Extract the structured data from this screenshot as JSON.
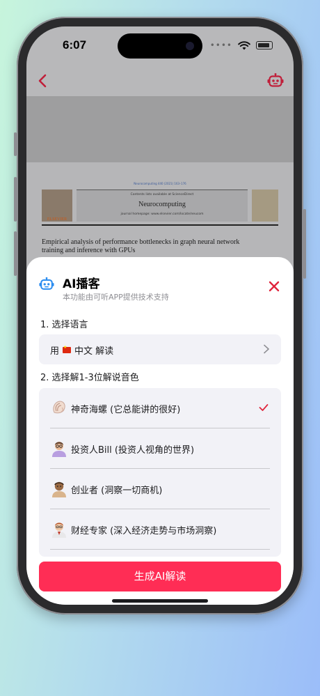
{
  "status_bar": {
    "time": "6:07",
    "dots": "••••"
  },
  "paper": {
    "journal_line": "Neurocomputing 440 (2021) 163–176",
    "contents_list": "Contents lists available at ScienceDirect",
    "journal_name": "Neurocomputing",
    "journal_homepage": "journal homepage: www.elsevier.com/locate/neucom",
    "publisher": "ELSEVIER",
    "title": "Empirical analysis of performance bottlenecks in graph neural network training and inference with GPUs"
  },
  "sheet": {
    "title": "AI播客",
    "subtitle": "本功能由可听APP提供技术支持",
    "step1_label": "1. 选择语言",
    "language_prefix": "用",
    "language_name": "中文 解读",
    "step2_label": "2. 选择解1-3位解说音色",
    "voices": [
      {
        "label": "神奇海螺 (它总能讲的很好)",
        "avatar": "conch-icon",
        "selected": true
      },
      {
        "label": "投资人Bill (投资人视角的世界)",
        "avatar": "investor-avatar",
        "selected": false
      },
      {
        "label": "创业者 (洞察一切商机)",
        "avatar": "entrepreneur-avatar",
        "selected": false
      },
      {
        "label": "财经专家 (深入经济走势与市场洞察)",
        "avatar": "finance-expert-avatar",
        "selected": false
      }
    ],
    "generate_button": "生成AI解读"
  },
  "colors": {
    "accent": "#ff2d55",
    "icon_red": "#e0243c",
    "icon_blue": "#2a8cf0",
    "row_bg": "#f2f2f7",
    "subtitle_gray": "#8e8e93"
  }
}
